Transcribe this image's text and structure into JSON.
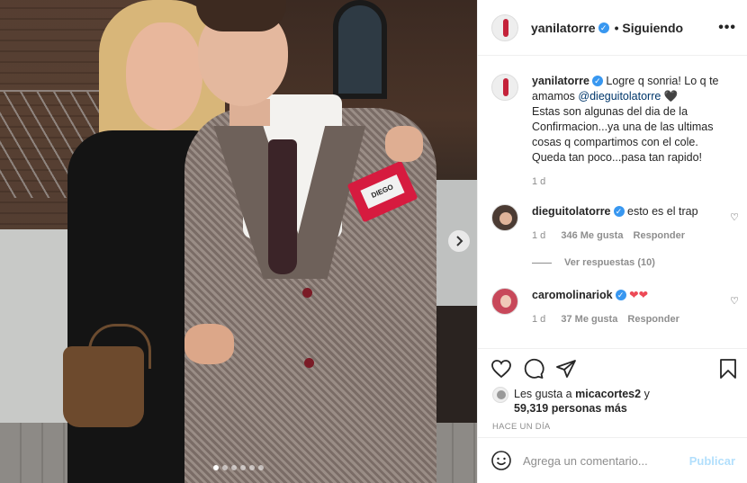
{
  "post": {
    "username": "yanilatorre",
    "follow_status": "• Siguiendo",
    "more_label": "•••"
  },
  "photo": {
    "name_tag": "DIEGO",
    "carousel_total": 6,
    "carousel_active": 1
  },
  "caption": {
    "username": "yanilatorre",
    "text_before": "Logre q sonria! Lo q te amamos ",
    "mention": "@dieguitolatorre",
    "emoji": "🖤",
    "text_after": "Estas son algunas del dia de la Confirmacion...ya una de las ultimas cosas q compartimos con el cole. Queda tan poco...pasa tan rapido!",
    "time": "1 d"
  },
  "comments": [
    {
      "username": "dieguitolatorre",
      "text": "esto es el trap",
      "time": "1 d",
      "likes": "346 Me gusta",
      "reply": "Responder",
      "view_replies": "Ver respuestas (10)"
    },
    {
      "username": "caromolinariok",
      "text": "❤❤",
      "time": "1 d",
      "likes": "37 Me gusta",
      "reply": "Responder"
    }
  ],
  "likes": {
    "prefix": "Les gusta a",
    "user": "micacortes2",
    "suffix": "y",
    "count": "59,319 personas más"
  },
  "timestamp": "HACE UN DÍA",
  "composer": {
    "placeholder": "Agrega un comentario...",
    "publish": "Publicar"
  },
  "colors": {
    "verified": "#3897f0",
    "publish_disabled": "#b2dffc",
    "heart": "#ed4956"
  },
  "icons": [
    "verified-icon",
    "more-options-icon",
    "heart-icon",
    "comment-icon",
    "share-icon",
    "bookmark-icon",
    "emoji-icon",
    "chevron-right-icon"
  ]
}
